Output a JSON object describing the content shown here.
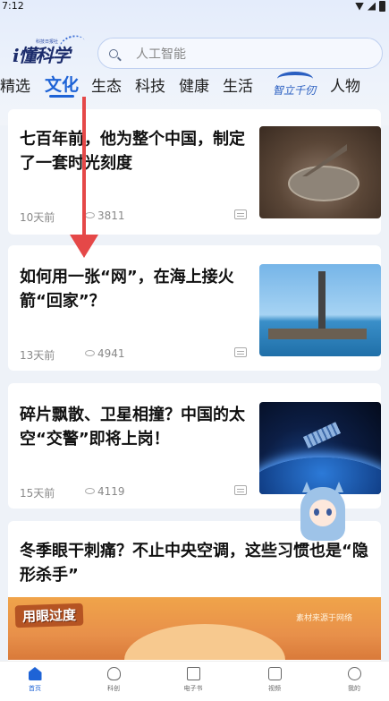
{
  "status_bar": {
    "time": "7:12"
  },
  "header": {
    "logo_text": "i懂科学",
    "logo_subtext": "科技日报社",
    "search_placeholder": "人工智能"
  },
  "tabs": [
    {
      "label": "精选"
    },
    {
      "label": "文化"
    },
    {
      "label": "生态"
    },
    {
      "label": "科技"
    },
    {
      "label": "健康"
    },
    {
      "label": "生活"
    },
    {
      "label": "智立千仞"
    },
    {
      "label": "人物"
    }
  ],
  "articles": [
    {
      "title": "七百年前，他为整个中国，制定了一套时光刻度",
      "time": "10天前",
      "views": "3811"
    },
    {
      "title": "如何用一张“网”，在海上接火箭“回家”？",
      "time": "13天前",
      "views": "4941"
    },
    {
      "title": "碎片飘散、卫星相撞？中国的太空“交警”即将上岗！",
      "time": "15天前",
      "views": "4119"
    },
    {
      "title": "冬季眼干刺痛？不止中央空调，这些习惯也是“隐形杀手”"
    }
  ],
  "card4_image": {
    "stamp_text": "用眼过度",
    "caption": "素材来源于网络"
  },
  "bottom_nav": [
    {
      "label": "首页"
    },
    {
      "label": "科创"
    },
    {
      "label": "电子书"
    },
    {
      "label": "视频"
    },
    {
      "label": "我的"
    }
  ],
  "colors": {
    "accent": "#1e63d6",
    "annotation_arrow": "#e54848"
  }
}
